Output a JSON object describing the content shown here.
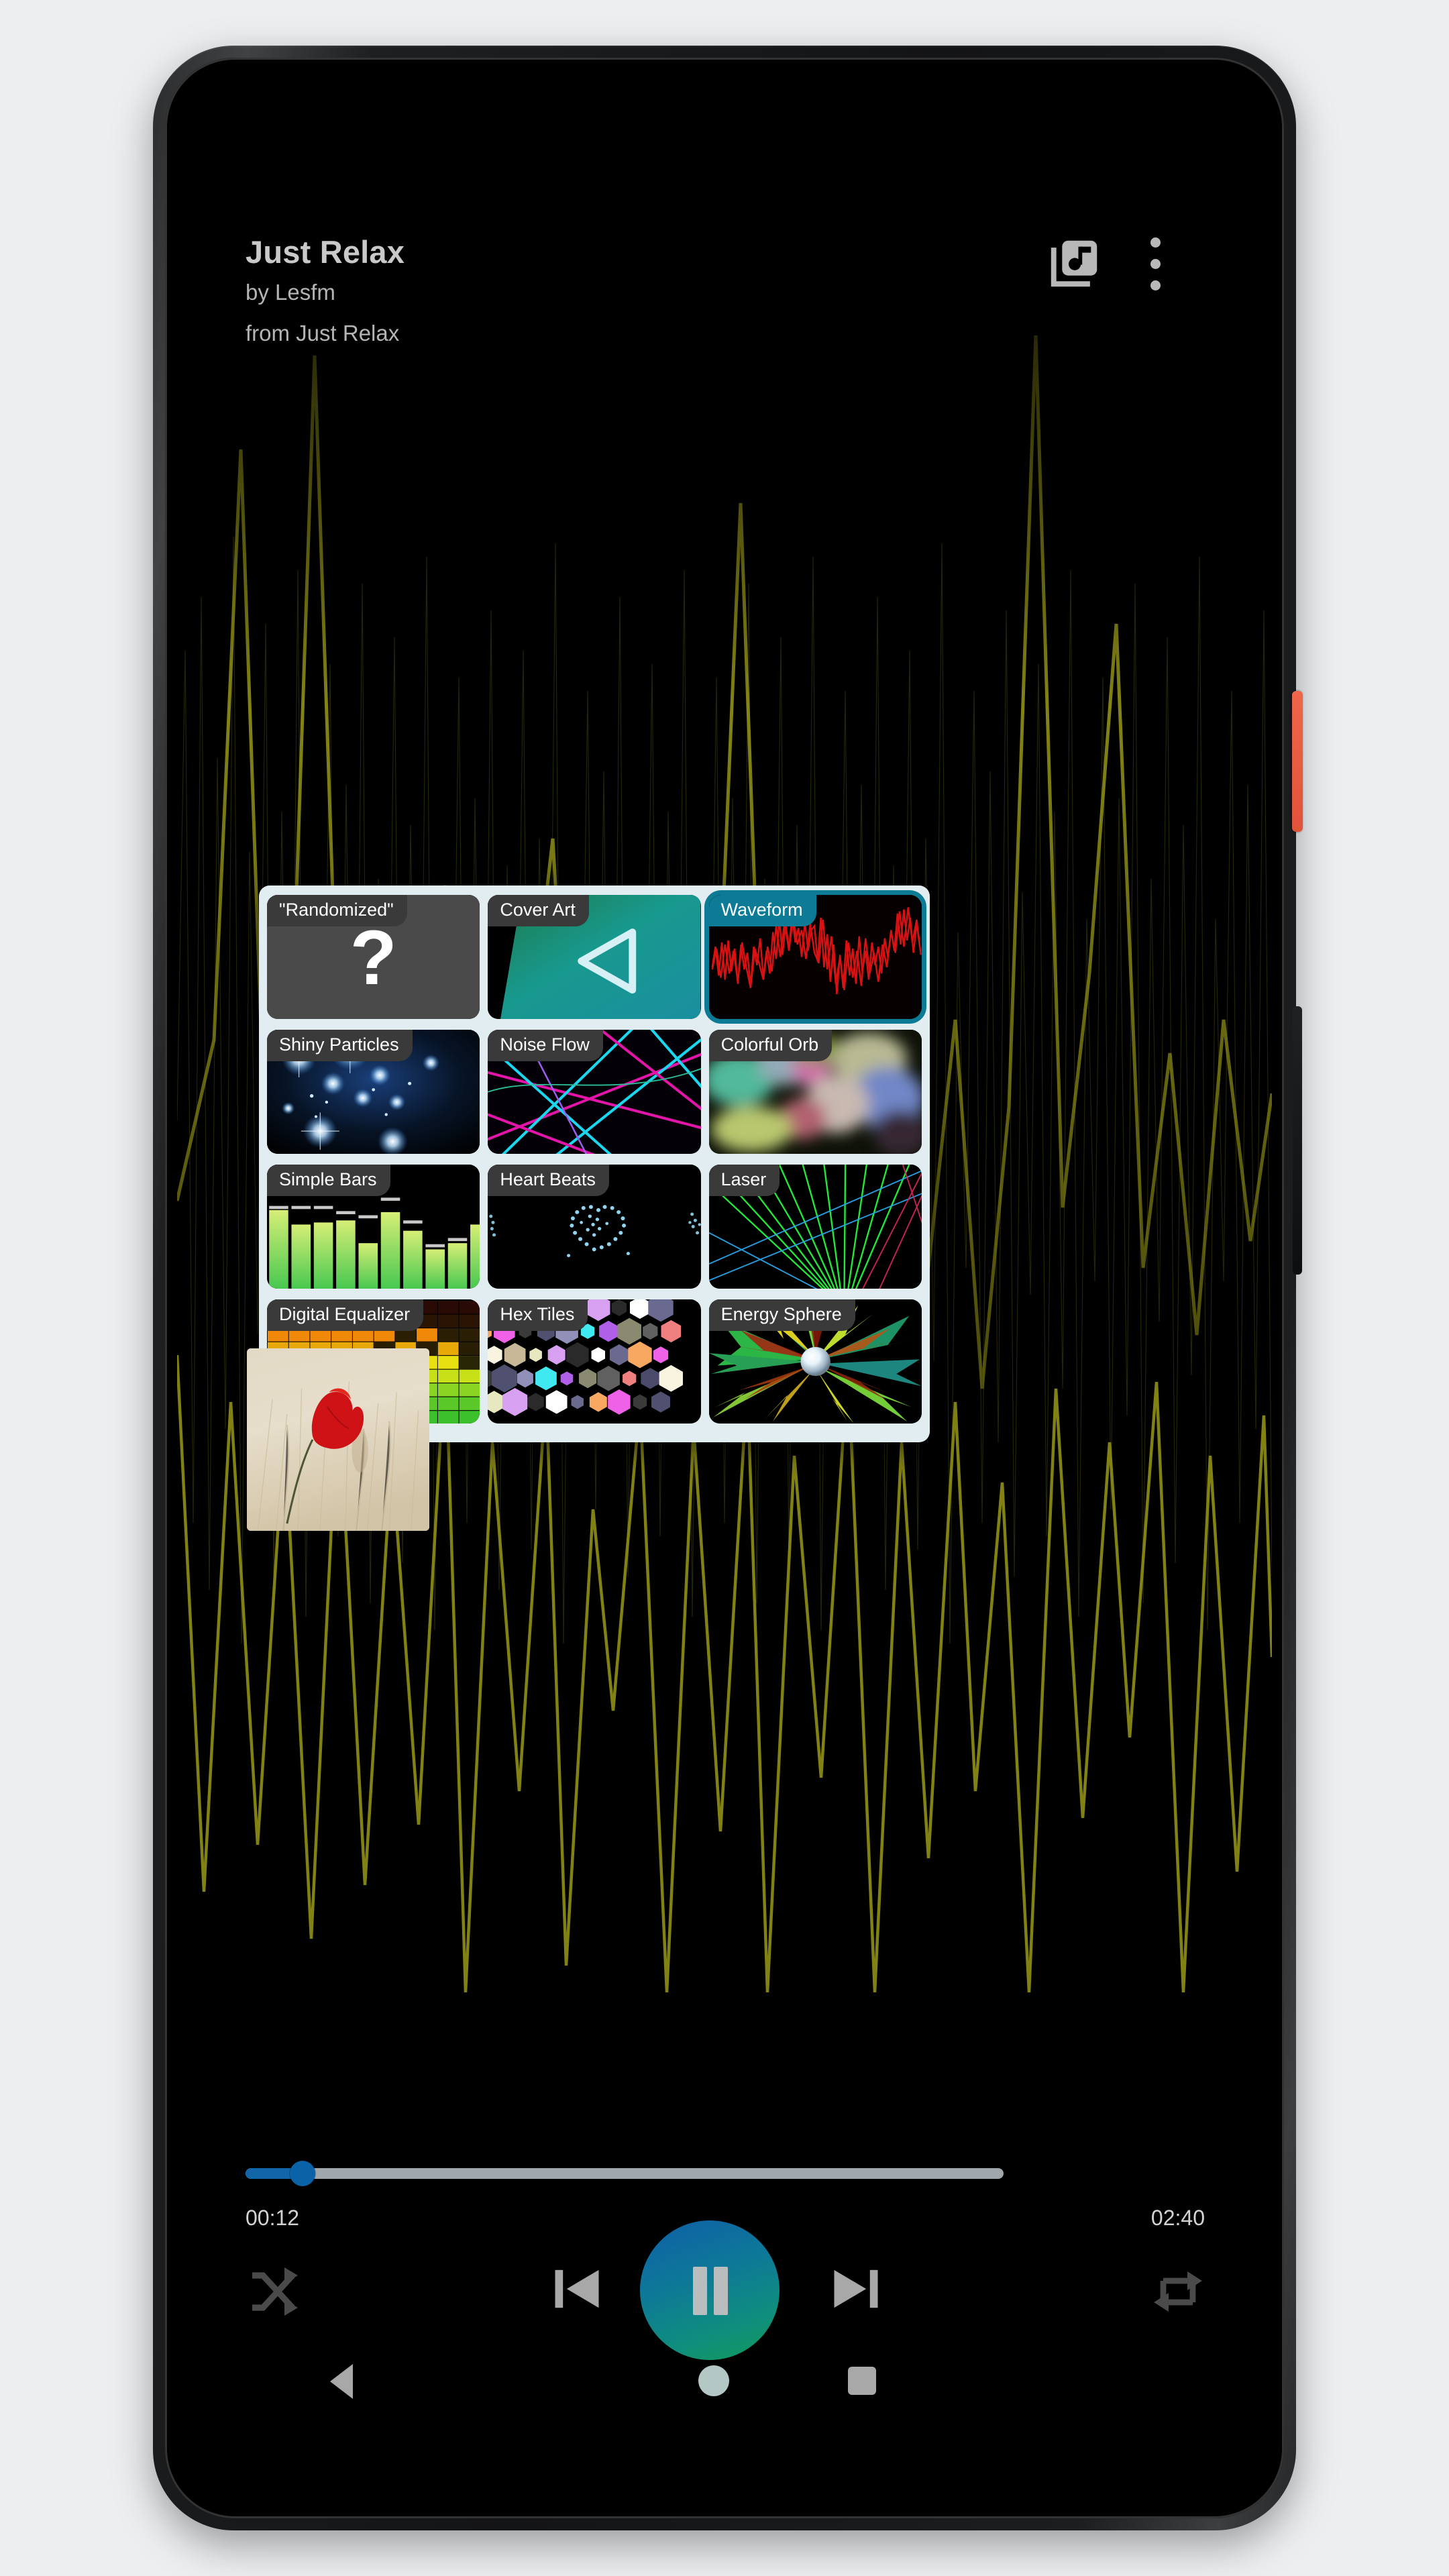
{
  "app": {
    "now_playing": {
      "title": "Just Relax",
      "artist_line": "by Lesfm",
      "album_line": "from Just Relax"
    },
    "header_actions": [
      {
        "name": "queue-icon",
        "label": "Queue"
      },
      {
        "name": "overflow-menu-icon",
        "label": "More options"
      }
    ],
    "background": {
      "visualizer_name": "waveform",
      "waveform_color": "#8a8a16",
      "screen_bg": "#000000"
    }
  },
  "visualizer_dialog": {
    "background_color": "#e2edf1",
    "selected_color": "#0d7b96",
    "label_color": "#3a3a3a",
    "selected_index": 2,
    "tiles": [
      {
        "label": "\"Randomized\"",
        "thumb": "question-mark",
        "selected": false
      },
      {
        "label": "Cover Art",
        "thumb": "cover-art",
        "selected": false
      },
      {
        "label": "Waveform",
        "thumb": "waveform",
        "selected": true
      },
      {
        "label": "Shiny Particles",
        "thumb": "shiny-particles",
        "selected": false
      },
      {
        "label": "Noise Flow",
        "thumb": "noise-flow",
        "selected": false
      },
      {
        "label": "Colorful Orb",
        "thumb": "colorful-orb",
        "selected": false
      },
      {
        "label": "Simple Bars",
        "thumb": "simple-bars",
        "selected": false
      },
      {
        "label": "Heart Beats",
        "thumb": "heart-beats",
        "selected": false
      },
      {
        "label": "Laser",
        "thumb": "laser",
        "selected": false
      },
      {
        "label": "Digital Equalizer",
        "thumb": "digital-equalizer",
        "selected": false
      },
      {
        "label": "Hex Tiles",
        "thumb": "hex-tiles",
        "selected": false
      },
      {
        "label": "Energy Sphere",
        "thumb": "energy-sphere",
        "selected": false
      }
    ]
  },
  "album_art": {
    "description": "red poppy flower in beige wheat field"
  },
  "player": {
    "time_current": "00:12",
    "time_total": "02:40",
    "progress_percent": 7.5,
    "seek_track_color": "#a0a8ae",
    "seek_progress_color": "#1166a8",
    "is_playing": true,
    "controls": [
      {
        "name": "shuffle-button",
        "label": "Shuffle",
        "active": false
      },
      {
        "name": "previous-button",
        "label": "Previous"
      },
      {
        "name": "play-pause-button",
        "label": "Pause"
      },
      {
        "name": "next-button",
        "label": "Next"
      },
      {
        "name": "repeat-button",
        "label": "Repeat",
        "active": false
      }
    ]
  },
  "nav_bar": {
    "items": [
      {
        "name": "nav-back-button",
        "label": "Back"
      },
      {
        "name": "nav-home-button",
        "label": "Home"
      },
      {
        "name": "nav-recents-button",
        "label": "Recents"
      }
    ]
  },
  "device": {
    "power_button_color": "#e85f42",
    "frame_color": "#17191b"
  }
}
